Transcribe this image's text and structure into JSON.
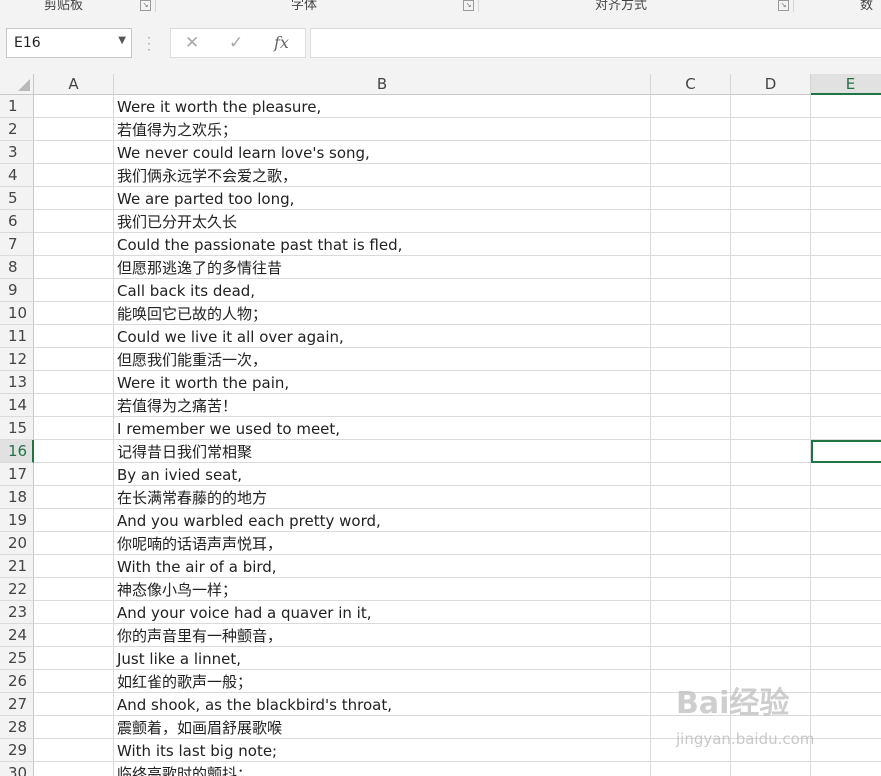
{
  "ribbon": {
    "groups": [
      "剪贴板",
      "字体",
      "对齐方式",
      "数字"
    ]
  },
  "namebox": {
    "value": "E16"
  },
  "formula": {
    "cancel_icon": "✕",
    "enter_icon": "✓",
    "fx_label": "fx",
    "value": ""
  },
  "columns": [
    "A",
    "B",
    "C",
    "D",
    "E"
  ],
  "selected": {
    "column": "E",
    "row": 16
  },
  "rows": [
    {
      "n": "1",
      "b": "Were it worth the pleasure,"
    },
    {
      "n": "2",
      "b": "若值得为之欢乐；"
    },
    {
      "n": "3",
      "b": "We never could learn love's song,"
    },
    {
      "n": "4",
      "b": "我们俩永远学不会爱之歌，"
    },
    {
      "n": "5",
      "b": "We are parted too long,"
    },
    {
      "n": "6",
      "b": "我们已分开太久长"
    },
    {
      "n": "7",
      "b": "Could the passionate past that is fled,"
    },
    {
      "n": "8",
      "b": "但愿那逃逸了的多情往昔"
    },
    {
      "n": "9",
      "b": "Call back its dead,"
    },
    {
      "n": "10",
      "b": "能唤回它已故的人物；"
    },
    {
      "n": "11",
      "b": "Could we live it all over again,"
    },
    {
      "n": "12",
      "b": "但愿我们能重活一次，"
    },
    {
      "n": "13",
      "b": "Were it worth the pain,"
    },
    {
      "n": "14",
      "b": "若值得为之痛苦！"
    },
    {
      "n": "15",
      "b": "I remember we used to meet,"
    },
    {
      "n": "16",
      "b": "记得昔日我们常相聚"
    },
    {
      "n": "17",
      "b": "By an ivied seat,"
    },
    {
      "n": "18",
      "b": "在长满常春藤的的地方"
    },
    {
      "n": "19",
      "b": "And you warbled each pretty word,"
    },
    {
      "n": "20",
      "b": "你呢喃的话语声声悦耳，"
    },
    {
      "n": "21",
      "b": "With the air of a bird,"
    },
    {
      "n": "22",
      "b": "神态像小鸟一样；"
    },
    {
      "n": "23",
      "b": "And your voice had a quaver in it,"
    },
    {
      "n": "24",
      "b": "你的声音里有一种颤音，"
    },
    {
      "n": "25",
      "b": "Just like a linnet,"
    },
    {
      "n": "26",
      "b": "如红雀的歌声一般；"
    },
    {
      "n": "27",
      "b": "And shook, as the blackbird's throat,"
    },
    {
      "n": "28",
      "b": "震颤着，如画眉舒展歌喉"
    },
    {
      "n": "29",
      "b": "With its last big note;"
    },
    {
      "n": "30",
      "b": "临终高歌时的颤抖；"
    }
  ],
  "watermark": {
    "logo": "Bai经验",
    "url": "jingyan.baidu.com"
  }
}
